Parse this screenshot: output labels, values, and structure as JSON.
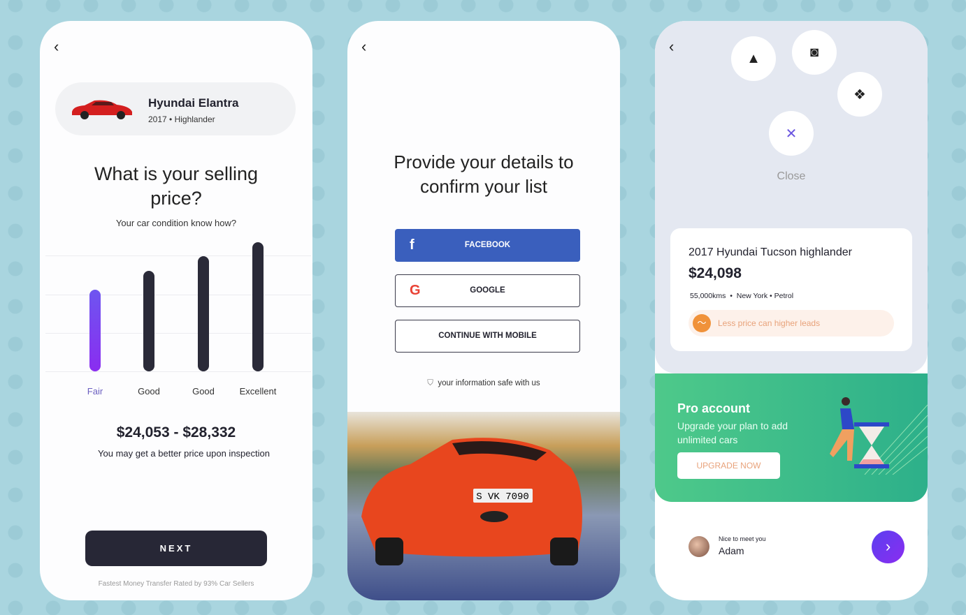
{
  "screen1": {
    "back": "‹",
    "car_name": "Hyundai Elantra",
    "car_year": "2017",
    "car_trim": "Highlander",
    "question": "What is your selling price?",
    "subtitle_a": "Your car condition ",
    "subtitle_b": "know how?",
    "condition_bars": [
      {
        "label": "Fair",
        "level": 0.63,
        "selected": true
      },
      {
        "label": "Good",
        "level": 0.78
      },
      {
        "label": "Good",
        "level": 0.89
      },
      {
        "label": "Excellent",
        "level": 1.0
      }
    ],
    "price_range": "$24,053 - $28,332",
    "price_note": "You may get a better price upon inspection",
    "next_label": "NEXT",
    "footer": "Fastest Money Transfer Rated by 93% Car Sellers",
    "accent": "#7b3ff0"
  },
  "screen2": {
    "back": "‹",
    "title": "Provide your details to confirm your list",
    "facebook_label": "FACEBOOK",
    "google_label": "GOOGLE",
    "mobile_label": "CONTINUE WITH MOBILE",
    "safe_note": "your information safe with us",
    "facebook_color": "#3a5fbd",
    "plate": "S VK 7090"
  },
  "screen3": {
    "back": "‹",
    "close_label": "Close",
    "close_glyph": "✕",
    "listing": {
      "title": "2017 Hyundai Tucson highlander",
      "price": "$24,098",
      "kms": "55,000kms",
      "city": "New York",
      "fuel": "Petrol",
      "tip": "Less price can higher leads"
    },
    "pro": {
      "title": "Pro account",
      "text": "Upgrade your plan to add unlimited cars",
      "button": "UPGRADE NOW"
    },
    "user": {
      "greeting": "Nice to meet you",
      "name": "Adam"
    },
    "green": "#3dbd89"
  }
}
